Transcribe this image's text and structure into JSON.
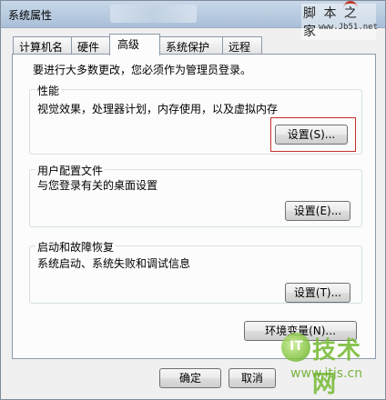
{
  "window": {
    "title": "系统属性"
  },
  "watermark": {
    "site_name": "脚 本 之 家",
    "site_url": "www.Jb51.net",
    "logo_text": "IT",
    "brand_text": "技术网",
    "brand_url": "www.itjs.cn"
  },
  "tabs": [
    {
      "label": "计算机名"
    },
    {
      "label": "硬件"
    },
    {
      "label": "高级",
      "active": true
    },
    {
      "label": "系统保护"
    },
    {
      "label": "远程"
    }
  ],
  "intro_text": "要进行大多数更改，您必须作为管理员登录。",
  "groups": {
    "performance": {
      "title": "性能",
      "desc": "视觉效果，处理器计划，内存使用，以及虚拟内存",
      "button": "设置(S)..."
    },
    "user_profiles": {
      "title": "用户配置文件",
      "desc": "与您登录有关的桌面设置",
      "button": "设置(E)..."
    },
    "startup_recovery": {
      "title": "启动和故障恢复",
      "desc": "系统启动、系统失败和调试信息",
      "button": "设置(T)..."
    }
  },
  "env_button": "环境变量(N)...",
  "footer": {
    "ok": "确定",
    "cancel": "取消"
  }
}
